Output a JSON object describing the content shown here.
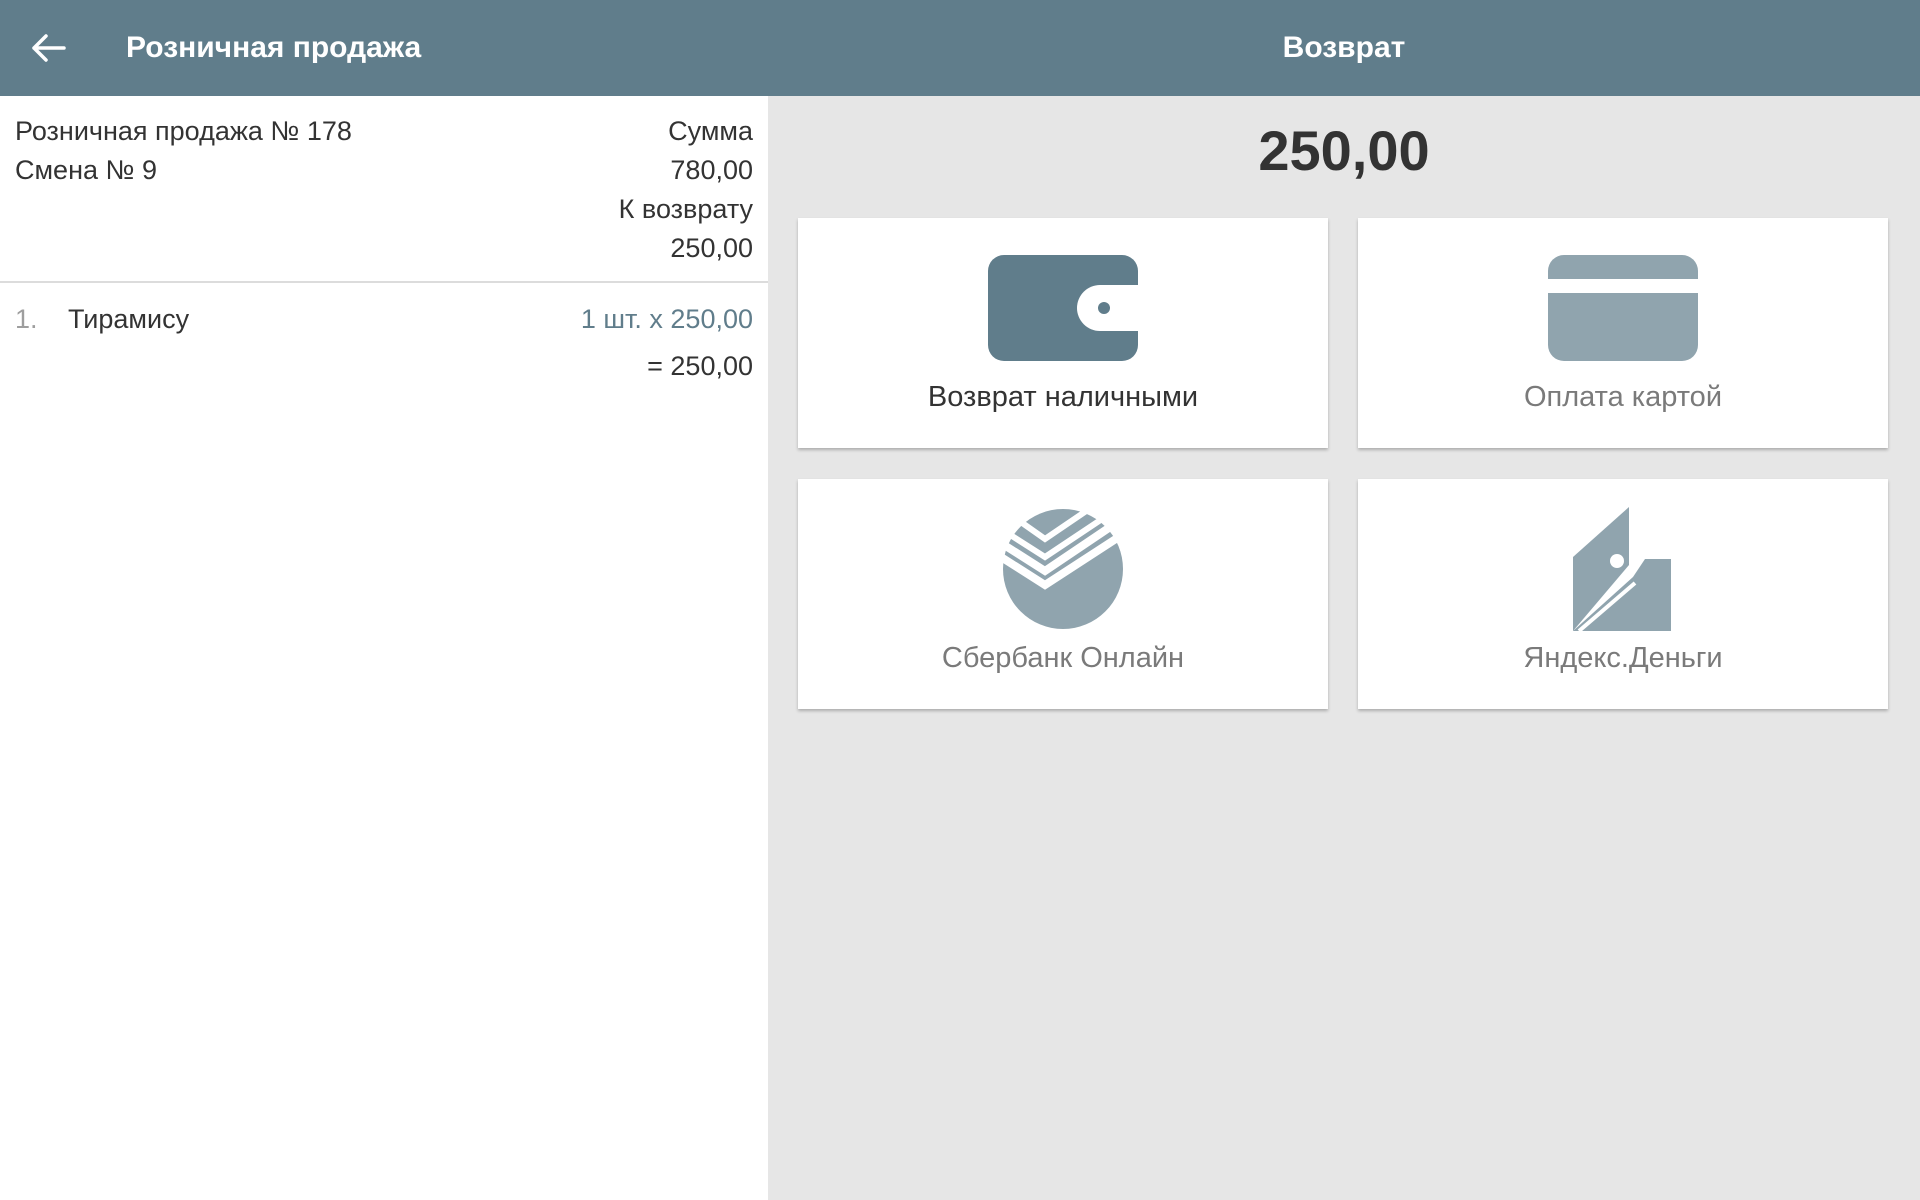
{
  "header": {
    "back_icon": "arrow-left-icon",
    "app_title": "Розничная продажа",
    "screen_title": "Возврат"
  },
  "document": {
    "number_label": "Розничная продажа № 178",
    "shift_label": "Смена № 9",
    "sum_label": "Сумма",
    "sum_value": "780,00",
    "refund_label": "К возврату",
    "refund_value": "250,00"
  },
  "items": [
    {
      "index": "1.",
      "name": "Тирамису",
      "qty_price": "1 шт. x 250,00",
      "total": "= 250,00"
    }
  ],
  "refund_amount": "250,00",
  "payment_methods": [
    {
      "label": "Возврат наличными",
      "icon": "wallet-icon",
      "active": true
    },
    {
      "label": "Оплата картой",
      "icon": "credit-card-icon",
      "active": false
    },
    {
      "label": "Сбербанк Онлайн",
      "icon": "sberbank-logo-icon",
      "active": false
    },
    {
      "label": "Яндекс.Деньги",
      "icon": "yandex-money-icon",
      "active": false
    }
  ],
  "colors": {
    "primary": "#607d8b",
    "icon_inactive": "#90a4ae",
    "panel_bg": "#e6e6e6"
  }
}
